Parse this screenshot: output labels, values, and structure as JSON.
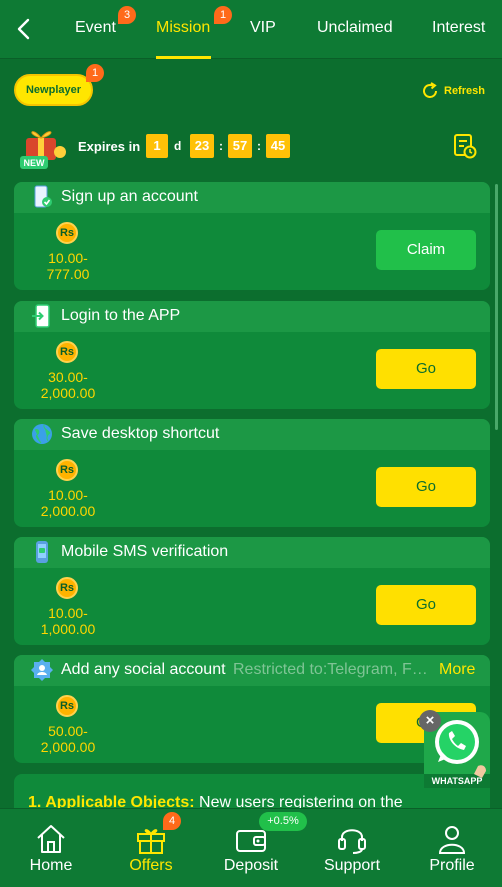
{
  "tabs": [
    {
      "label": "Event",
      "badge": "3"
    },
    {
      "label": "Mission",
      "badge": "1",
      "active": true
    },
    {
      "label": "VIP"
    },
    {
      "label": "Unclaimed"
    },
    {
      "label": "Interest"
    }
  ],
  "subheader": {
    "newplayer_label": "Newplayer",
    "newplayer_badge": "1",
    "refresh_label": "Refresh",
    "gift_label": "NEW",
    "expires_label": "Expires in",
    "countdown": {
      "days": "1",
      "day_unit": "d",
      "hours": "23",
      "minutes": "57",
      "seconds": "45",
      "sep": ":"
    }
  },
  "missions": [
    {
      "title": "Sign up an account",
      "coin": "Rs",
      "reward": "10.00-777.00",
      "action": "Claim",
      "icon": "phone-check-icon"
    },
    {
      "title": "Login to the APP",
      "coin": "Rs",
      "reward": "30.00-2,000.00",
      "action": "Go",
      "icon": "login-phone-icon"
    },
    {
      "title": "Save desktop shortcut",
      "coin": "Rs",
      "reward": "10.00-2,000.00",
      "action": "Go",
      "icon": "globe-icon"
    },
    {
      "title": "Mobile SMS verification",
      "coin": "Rs",
      "reward": "10.00-1,000.00",
      "action": "Go",
      "icon": "sms-phone-icon"
    },
    {
      "title": "Add any social account",
      "restricted": "Restricted to:Telegram, F…",
      "more": "More",
      "coin": "Rs",
      "reward": "50.00-2,000.00",
      "action": "Go",
      "icon": "social-icon"
    }
  ],
  "rules": {
    "heading": "1. Applicable Objects:",
    "text": "New users registering on the"
  },
  "whatsapp": {
    "label": "WHATSAPP"
  },
  "nav": [
    {
      "label": "Home"
    },
    {
      "label": "Offers",
      "badge": "4",
      "active": true
    },
    {
      "label": "Deposit",
      "pill": "+0.5%"
    },
    {
      "label": "Support"
    },
    {
      "label": "Profile"
    }
  ],
  "colors": {
    "accent": "#ffe600",
    "background": "#0c6e2e",
    "card": "#0f8a3a",
    "badge": "#ff6a1a",
    "claim": "#21c04a"
  }
}
